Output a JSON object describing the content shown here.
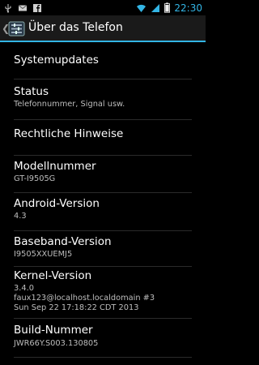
{
  "status_bar": {
    "time": "22:30",
    "left_icons": [
      "usb-icon",
      "gmail-icon",
      "facebook-icon"
    ],
    "right_icons": [
      "wifi-icon",
      "signal-icon",
      "battery-icon"
    ]
  },
  "action_bar": {
    "title": "Über das Telefon",
    "accent": "#33b5e5"
  },
  "items": [
    {
      "title": "Systemupdates",
      "summary": []
    },
    {
      "title": "Status",
      "summary": [
        "Telefonnummer, Signal usw."
      ]
    },
    {
      "title": "Rechtliche Hinweise",
      "summary": []
    },
    {
      "title": "Modellnummer",
      "summary": [
        "GT-I9505G"
      ]
    },
    {
      "title": "Android-Version",
      "summary": [
        "4.3"
      ]
    },
    {
      "title": "Baseband-Version",
      "summary": [
        "I9505XXUEMJ5"
      ]
    },
    {
      "title": "Kernel-Version",
      "summary": [
        "3.4.0",
        "faux123@localhost.localdomain #3",
        "Sun Sep 22 17:18:22 CDT 2013"
      ]
    },
    {
      "title": "Build-Nummer",
      "summary": [
        "JWR66Y.S003.130805"
      ]
    }
  ]
}
